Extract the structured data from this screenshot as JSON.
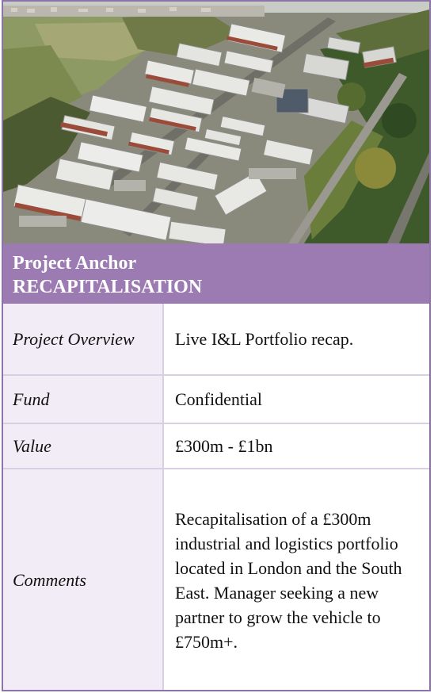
{
  "image": {
    "alt": "Aerial view of an industrial and logistics park"
  },
  "header": {
    "line1": "Project Anchor",
    "line2": "RECAPITALISATION"
  },
  "rows": [
    {
      "label": "Project Overview",
      "value": "Live I&L Portfolio recap."
    },
    {
      "label": "Fund",
      "value": "Confidential"
    },
    {
      "label": "Value",
      "value": "£300m - £1bn"
    },
    {
      "label": "Comments",
      "value": "Recapitalisation of a £300m industrial and logistics portfolio located in London and the South East. Manager seeking a new partner to grow the vehicle to £750m+."
    }
  ],
  "colors": {
    "header_band": "#9b7bb1",
    "label_cell": "#f1ecf5",
    "border": "#8e73a8"
  }
}
